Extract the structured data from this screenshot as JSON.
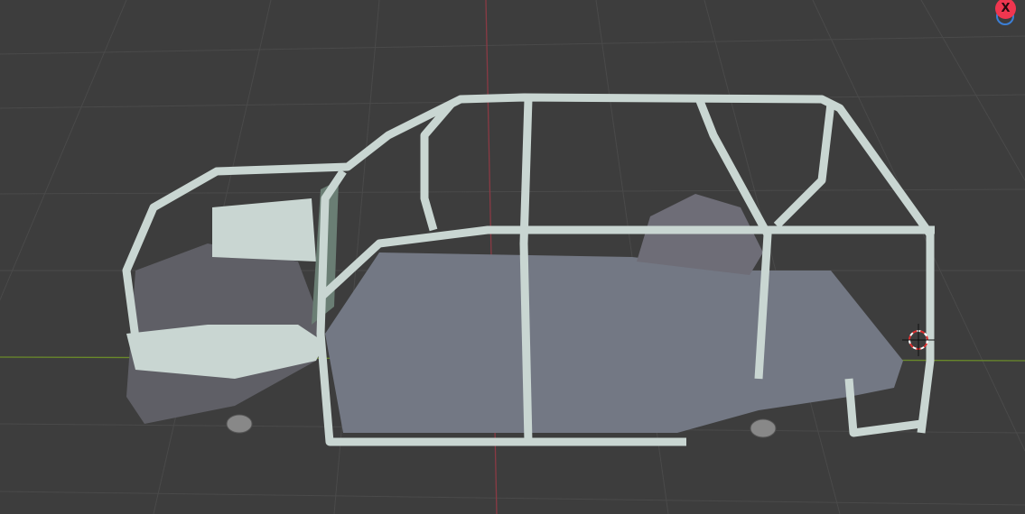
{
  "viewport": {
    "gizmo": {
      "x_axis_label": "X"
    },
    "colors": {
      "background": "#3d3d3d",
      "grid": "#4a4a4a",
      "x_axis": "#8a3a44",
      "y_axis": "#6a8a2a",
      "body": "#c9d6d2",
      "floor": "#737884"
    }
  }
}
